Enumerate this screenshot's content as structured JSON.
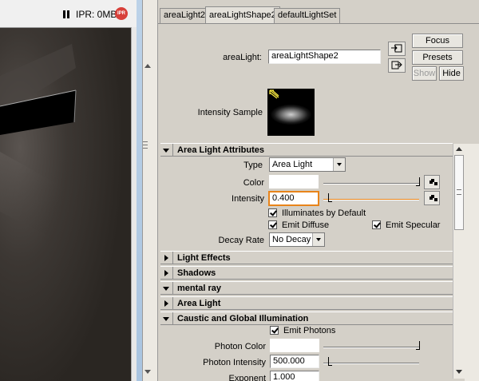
{
  "render_view": {
    "ipr_status": "IPR: 0MB",
    "ipr_icon_text": "IPR",
    "icons": [
      "pause-icon",
      "ipr-icon"
    ]
  },
  "tabs": [
    {
      "label": "areaLight2",
      "active": false
    },
    {
      "label": "areaLightShape2",
      "active": true
    },
    {
      "label": "defaultLightSet",
      "active": false
    }
  ],
  "header": {
    "node_label": "areaLight:",
    "node_value": "areaLightShape2",
    "focus_label": "Focus",
    "presets_label": "Presets",
    "show_label": "Show",
    "hide_label": "Hide",
    "load_icon": "load-attributes-icon",
    "copy_icon": "copy-tab-icon"
  },
  "intensity_sample": {
    "label": "Intensity Sample"
  },
  "sections": {
    "area_light_attributes": "Area Light Attributes",
    "light_effects": "Light Effects",
    "shadows": "Shadows",
    "mental_ray": "mental ray",
    "area_light": "Area Light",
    "caustic": "Caustic and Global Illumination"
  },
  "attributes": {
    "type_label": "Type",
    "type_value": "Area Light",
    "color_label": "Color",
    "color_value": "#ffffff",
    "color_slider_fraction": 1.0,
    "intensity_label": "Intensity",
    "intensity_value": "0.400",
    "intensity_slider_fraction": 0.04,
    "illuminates_label": "Illuminates by Default",
    "illuminates_checked": true,
    "emit_diffuse_label": "Emit Diffuse",
    "emit_diffuse_checked": true,
    "emit_specular_label": "Emit Specular",
    "emit_specular_checked": true,
    "decay_label": "Decay Rate",
    "decay_value": "No Decay"
  },
  "caustic": {
    "emit_photons_label": "Emit Photons",
    "emit_photons_checked": true,
    "photon_color_label": "Photon Color",
    "photon_color_value": "#ffffff",
    "photon_color_slider_fraction": 1.0,
    "photon_intensity_label": "Photon Intensity",
    "photon_intensity_value": "500.000",
    "photon_intensity_slider_fraction": 0.05,
    "exponent_label": "Exponent",
    "exponent_value": "1.000"
  },
  "colors": {
    "focus_highlight": "#e8841a",
    "window_bg": "#d4d0c8",
    "ipr_icon": "#d8403a"
  }
}
